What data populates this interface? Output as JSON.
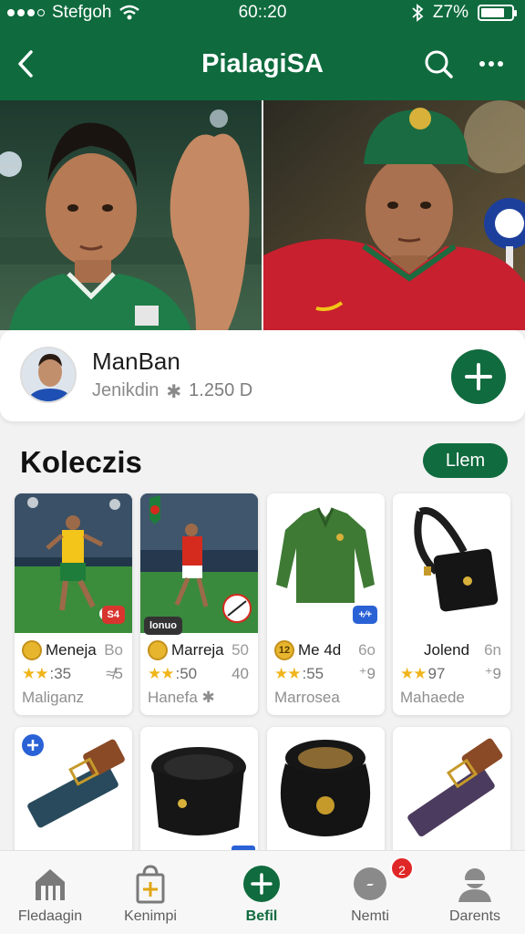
{
  "status_bar": {
    "carrier": "Stefgoh",
    "time": "60::20",
    "battery": "Z7%",
    "battery_level": 0.77
  },
  "app_bar": {
    "title": "PialagiSA",
    "back_icon": "chevron-left-icon",
    "search_icon": "search-icon",
    "more_icon": "more-horizontal-icon"
  },
  "profile": {
    "name": "ManBan",
    "meta_label": "Jenikdin",
    "meta_sep": "✱",
    "meta_value": "1.250 D",
    "add_icon": "plus-icon"
  },
  "section": {
    "title": "Koleczis",
    "button": "Llem"
  },
  "cards": [
    {
      "coin": "",
      "name": "Meneja",
      "side": "Bo",
      "rating": "★★",
      "r1": ":35",
      "r2": "≉5",
      "sub": "Maliganz",
      "tag": "S4",
      "tag_color": "#d8352f"
    },
    {
      "coin": "",
      "name": "Marreja",
      "side": "50",
      "rating": "★★",
      "r1": ":50",
      "r2": "40",
      "sub": "Hanefa ✱",
      "tag": "lonuo",
      "tag_color": "#333333"
    },
    {
      "coin": "12",
      "name": "Me 4d",
      "side": "6o",
      "rating": "★★",
      "r1": ":55",
      "r2": "⁺9",
      "sub": "Marrosea",
      "tag": "+⁄+",
      "tag_color": "#2a62d6"
    },
    {
      "coin": "",
      "name": "Jolend",
      "side": "6n",
      "rating": "★★",
      "r1": "97",
      "r2": "⁺9",
      "sub": "Mahaede",
      "tag": "",
      "tag_color": ""
    }
  ],
  "nav": [
    {
      "label": "Fledaagin",
      "icon": "home-icon"
    },
    {
      "label": "Kenimpi",
      "icon": "shopping-bag-icon"
    },
    {
      "label": "Befil",
      "icon": "plus-circle-icon"
    },
    {
      "label": "Nemti",
      "icon": "compass-icon"
    },
    {
      "label": "Darents",
      "icon": "profile-icon"
    }
  ],
  "notification_badge": "2",
  "colors": {
    "brand_green": "#106b3e",
    "star": "#f0b51b",
    "badge_red": "#e02727"
  }
}
